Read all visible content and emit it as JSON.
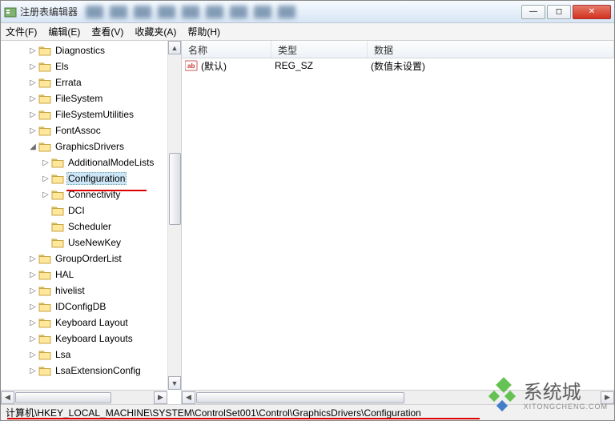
{
  "window": {
    "title": "注册表编辑器"
  },
  "menubar": {
    "file": "文件(F)",
    "edit": "编辑(E)",
    "view": "查看(V)",
    "favorites": "收藏夹(A)",
    "help": "帮助(H)"
  },
  "tree": {
    "items": [
      {
        "indent": 2,
        "exp": "▷",
        "label": "Diagnostics"
      },
      {
        "indent": 2,
        "exp": "▷",
        "label": "Els"
      },
      {
        "indent": 2,
        "exp": "▷",
        "label": "Errata"
      },
      {
        "indent": 2,
        "exp": "▷",
        "label": "FileSystem"
      },
      {
        "indent": 2,
        "exp": "▷",
        "label": "FileSystemUtilities"
      },
      {
        "indent": 2,
        "exp": "▷",
        "label": "FontAssoc"
      },
      {
        "indent": 2,
        "exp": "◢",
        "label": "GraphicsDrivers"
      },
      {
        "indent": 3,
        "exp": "▷",
        "label": "AdditionalModeLists"
      },
      {
        "indent": 3,
        "exp": "▷",
        "label": "Configuration",
        "selected": true
      },
      {
        "indent": 3,
        "exp": "▷",
        "label": "Connectivity"
      },
      {
        "indent": 3,
        "exp": "",
        "label": "DCI"
      },
      {
        "indent": 3,
        "exp": "",
        "label": "Scheduler"
      },
      {
        "indent": 3,
        "exp": "",
        "label": "UseNewKey"
      },
      {
        "indent": 2,
        "exp": "▷",
        "label": "GroupOrderList"
      },
      {
        "indent": 2,
        "exp": "▷",
        "label": "HAL"
      },
      {
        "indent": 2,
        "exp": "▷",
        "label": "hivelist"
      },
      {
        "indent": 2,
        "exp": "▷",
        "label": "IDConfigDB"
      },
      {
        "indent": 2,
        "exp": "▷",
        "label": "Keyboard Layout"
      },
      {
        "indent": 2,
        "exp": "▷",
        "label": "Keyboard Layouts"
      },
      {
        "indent": 2,
        "exp": "▷",
        "label": "Lsa"
      },
      {
        "indent": 2,
        "exp": "▷",
        "label": "LsaExtensionConfig"
      }
    ]
  },
  "list": {
    "columns": {
      "name": "名称",
      "type": "类型",
      "data": "数据"
    },
    "col_widths": {
      "name": 112,
      "type": 120,
      "data": 260
    },
    "rows": [
      {
        "name": "(默认)",
        "type": "REG_SZ",
        "data": "(数值未设置)"
      }
    ]
  },
  "statusbar": {
    "path": "计算机\\HKEY_LOCAL_MACHINE\\SYSTEM\\ControlSet001\\Control\\GraphicsDrivers\\Configuration"
  },
  "watermark": {
    "title": "系统城",
    "sub": "XITONGCHENG.COM"
  }
}
